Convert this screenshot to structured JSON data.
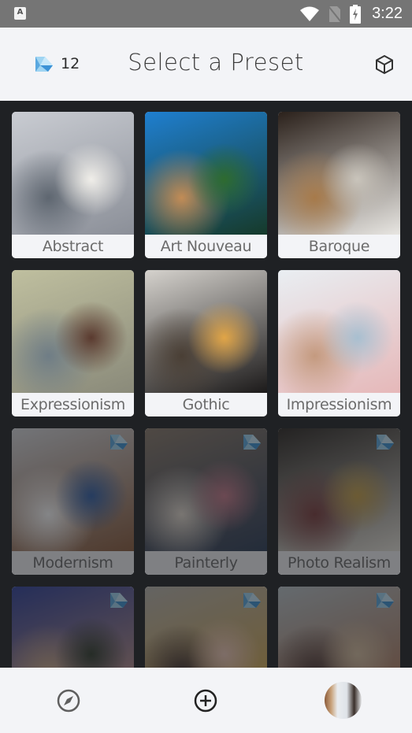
{
  "status_bar": {
    "notification_icon": "text-a-icon",
    "wifi_icon": "wifi-icon",
    "signal_icon": "no-sim-icon",
    "battery_icon": "battery-charging-icon",
    "time": "3:22"
  },
  "header": {
    "credits_icon": "diamond-gem-icon",
    "credits_count": "12",
    "title": "Select a Preset",
    "right_icon": "cube-icon"
  },
  "presets": [
    {
      "label": "Abstract",
      "locked": false,
      "palette": [
        "#c9ccd2",
        "#8b8f98",
        "#f0eee9",
        "#5e6670"
      ]
    },
    {
      "label": "Art Nouveau",
      "locked": false,
      "palette": [
        "#1f7fd0",
        "#163a2a",
        "#2e6b2f",
        "#c28c56"
      ]
    },
    {
      "label": "Baroque",
      "locked": false,
      "palette": [
        "#2b211b",
        "#e8e6e2",
        "#c9c4bb",
        "#a77a4a"
      ]
    },
    {
      "label": "Expressionism",
      "locked": false,
      "palette": [
        "#bfbf9f",
        "#8a8a7a",
        "#5a3a2f",
        "#6f7d86"
      ]
    },
    {
      "label": "Gothic",
      "locked": false,
      "palette": [
        "#d5d2cd",
        "#1c1a1a",
        "#e1a547",
        "#4a3f35"
      ]
    },
    {
      "label": "Impressionism",
      "locked": false,
      "palette": [
        "#e9eef2",
        "#e6b8b9",
        "#a8bfd0",
        "#c49a7f"
      ]
    },
    {
      "label": "Modernism",
      "locked": true,
      "palette": [
        "#d9dbdf",
        "#8a5a3a",
        "#2f5fa8",
        "#ffffff"
      ]
    },
    {
      "label": "Painterly",
      "locked": true,
      "palette": [
        "#8a7a6a",
        "#2a3a55",
        "#c87a8a",
        "#e6dcd0"
      ]
    },
    {
      "label": "Photo Realism",
      "locked": true,
      "palette": [
        "#2a2520",
        "#e8e4da",
        "#c9a247",
        "#7a3a3a"
      ]
    },
    {
      "label": "",
      "locked": true,
      "palette": [
        "#2d3f9a",
        "#d8a083",
        "#2f3a2a",
        "#c9a88a"
      ]
    },
    {
      "label": "",
      "locked": true,
      "palette": [
        "#b8b4ad",
        "#d9a63a",
        "#f0c9b8",
        "#3a2a2a"
      ]
    },
    {
      "label": "",
      "locked": true,
      "palette": [
        "#b9c3c8",
        "#b0704a",
        "#d8c0a0",
        "#4a3430"
      ]
    }
  ],
  "bottom_nav": {
    "explore_icon": "compass-icon",
    "create_icon": "plus-circle-icon",
    "profile_icon": "avatar"
  }
}
